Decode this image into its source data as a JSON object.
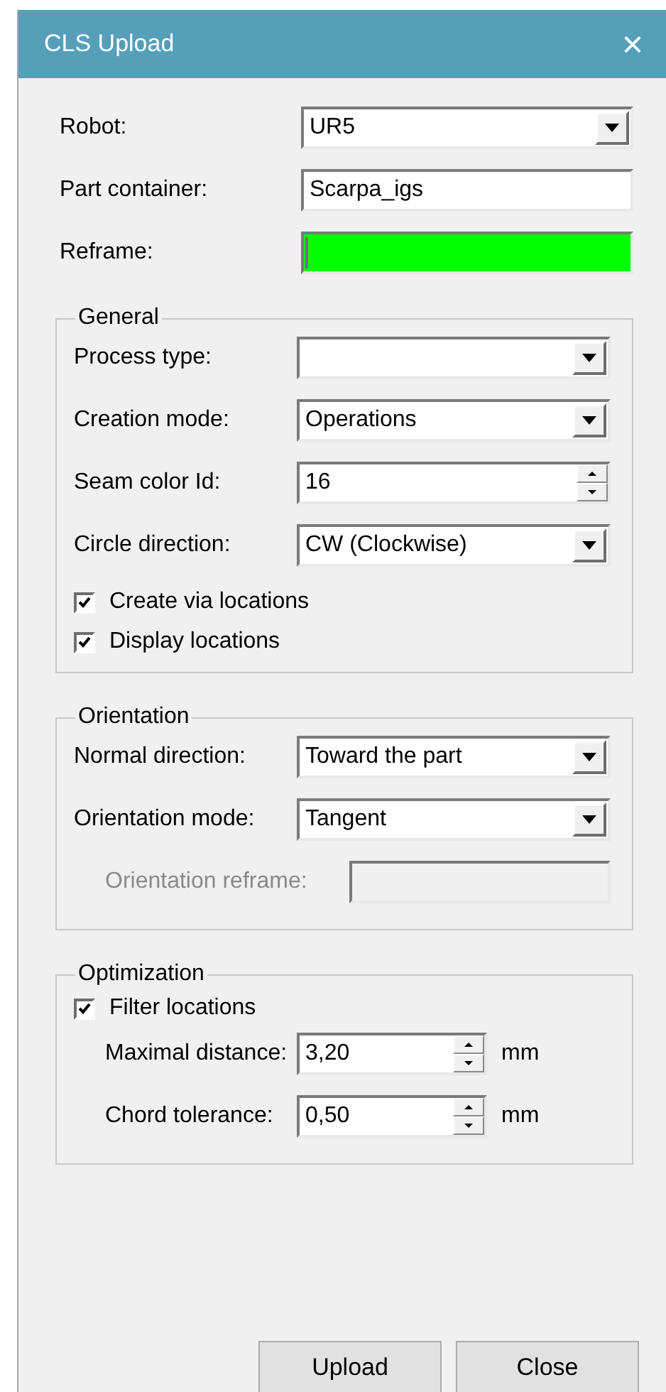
{
  "window": {
    "title": "CLS Upload",
    "close": "×"
  },
  "fields": [
    {
      "kind": "dropdown",
      "label": "Robot:",
      "value": "UR5"
    },
    {
      "kind": "text",
      "label": "Part container:",
      "value": "Scarpa_igs"
    },
    {
      "kind": "color",
      "label": "Reframe:",
      "color": "#00ff00"
    }
  ],
  "groups": [
    {
      "title": "General",
      "rows": [
        {
          "kind": "dropdown",
          "label": "Process type:",
          "value": ""
        },
        {
          "kind": "dropdown",
          "label": "Creation mode:",
          "value": "Operations"
        },
        {
          "kind": "spin",
          "label": "Seam color Id:",
          "value": "16"
        },
        {
          "kind": "dropdown",
          "label": "Circle direction:",
          "value": "CW (Clockwise)"
        },
        {
          "kind": "checkbox",
          "label": "Create via locations",
          "checked": true
        },
        {
          "kind": "checkbox",
          "label": "Display locations",
          "checked": true
        }
      ]
    },
    {
      "title": "Orientation",
      "rows": [
        {
          "kind": "dropdown",
          "label": "Normal direction:",
          "value": "Toward the part"
        },
        {
          "kind": "dropdown",
          "label": "Orientation mode:",
          "value": "Tangent"
        },
        {
          "kind": "text",
          "label": "Orientation reframe:",
          "value": "",
          "disabled": true
        }
      ]
    },
    {
      "title": "Optimization",
      "rows": [
        {
          "kind": "checkbox",
          "label": "Filter locations",
          "checked": true
        },
        {
          "kind": "spin",
          "label": "Maximal distance:",
          "value": "3,20",
          "unit": "mm"
        },
        {
          "kind": "spin",
          "label": "Chord tolerance:",
          "value": "0,50",
          "unit": "mm"
        }
      ]
    }
  ],
  "buttons": [
    "Upload",
    "Close"
  ]
}
